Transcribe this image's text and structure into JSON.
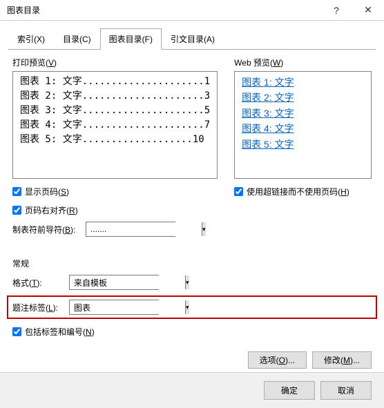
{
  "title": "图表目录",
  "tabs": [
    "索引(X)",
    "目录(C)",
    "图表目录(F)",
    "引文目录(A)"
  ],
  "active_tab": 2,
  "print_preview": {
    "label": "打印预览",
    "hotkey": "V",
    "lines": [
      "图表 1: 文字.....................1",
      "图表 2: 文字.....................3",
      "图表 3: 文字.....................5",
      "图表 4: 文字.....................7",
      "图表 5: 文字...................10"
    ]
  },
  "web_preview": {
    "label": "Web 预览",
    "hotkey": "W",
    "lines": [
      "图表 1: 文字",
      "图表 2: 文字",
      "图表 3: 文字",
      "图表 4: 文字",
      "图表 5: 文字"
    ]
  },
  "show_page_numbers": {
    "label": "显示页码",
    "hotkey": "S",
    "checked": true
  },
  "right_align": {
    "label": "页码右对齐",
    "hotkey": "R",
    "checked": true
  },
  "use_hyperlinks": {
    "label": "使用超链接而不使用页码",
    "hotkey": "H",
    "checked": true
  },
  "tab_leader": {
    "label": "制表符前导符",
    "hotkey": "B",
    "value": "......."
  },
  "general_section": "常规",
  "format": {
    "label": "格式",
    "hotkey": "T",
    "value": "来自模板"
  },
  "caption_label": {
    "label": "题注标签",
    "hotkey": "L",
    "value": "图表"
  },
  "include_label": {
    "label": "包括标签和编号",
    "hotkey": "N",
    "checked": true
  },
  "options_btn": "选项(O)...",
  "modify_btn": "修改(M)...",
  "ok_btn": "确定",
  "cancel_btn": "取消"
}
